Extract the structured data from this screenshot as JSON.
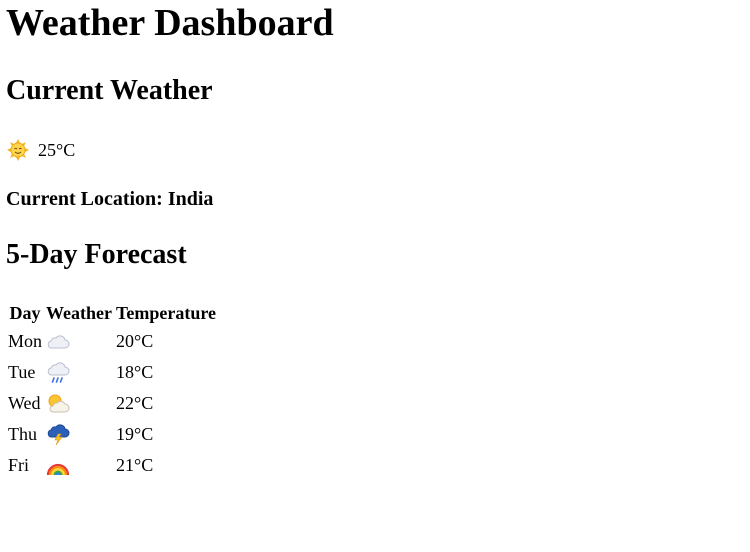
{
  "title": "Weather Dashboard",
  "current": {
    "heading": "Current Weather",
    "icon": "sun-with-face-icon",
    "temperature": "25°C",
    "location_text": "Current Location: India"
  },
  "forecast": {
    "heading": "5-Day Forecast",
    "columns": [
      "Day",
      "Weather",
      "Temperature"
    ],
    "rows": [
      {
        "day": "Mon",
        "icon": "cloud-icon",
        "temp": "20°C"
      },
      {
        "day": "Tue",
        "icon": "cloud-rain-icon",
        "temp": "18°C"
      },
      {
        "day": "Wed",
        "icon": "sun-behind-cloud-icon",
        "temp": "22°C"
      },
      {
        "day": "Thu",
        "icon": "cloud-lightning-icon",
        "temp": "19°C"
      },
      {
        "day": "Fri",
        "icon": "rainbow-icon",
        "temp": "21°C"
      }
    ]
  }
}
